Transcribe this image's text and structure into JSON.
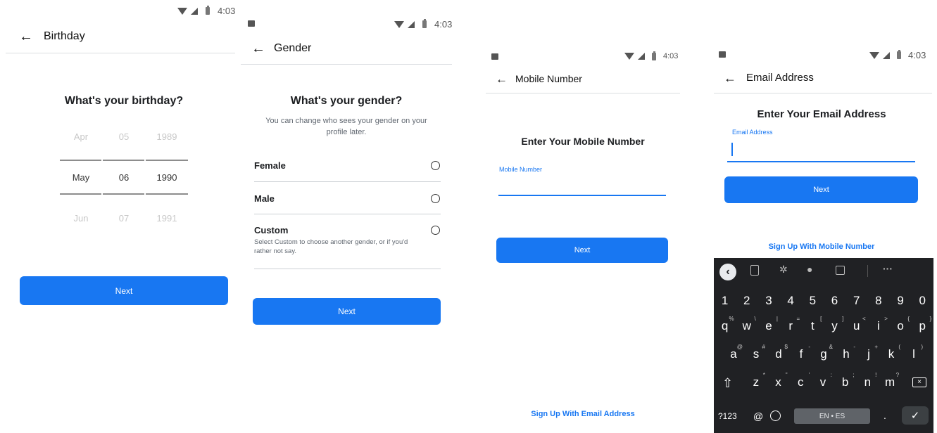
{
  "status_time": "4:03",
  "common": {
    "back_glyph": "←"
  },
  "screen1": {
    "title": "Birthday",
    "heading": "What's your birthday?",
    "months": [
      "Apr",
      "May",
      "Jun"
    ],
    "days": [
      "05",
      "06",
      "07"
    ],
    "years": [
      "1989",
      "1990",
      "1991"
    ],
    "next_label": "Next"
  },
  "screen2": {
    "title": "Gender",
    "heading": "What's your gender?",
    "subtitle": "You can change who sees your gender on your profile later.",
    "options": [
      {
        "label": "Female"
      },
      {
        "label": "Male"
      },
      {
        "label": "Custom",
        "desc": "Select Custom to choose another gender, or if you'd rather not say."
      }
    ],
    "next_label": "Next"
  },
  "screen3": {
    "title": "Mobile Number",
    "heading": "Enter Your Mobile Number",
    "field_label": "Mobile Number",
    "next_label": "Next",
    "alt_link": "Sign Up With Email Address"
  },
  "screen4": {
    "title": "Email Address",
    "heading": "Enter Your Email Address",
    "field_label": "Email Address",
    "next_label": "Next",
    "alt_link": "Sign Up With Mobile Number"
  },
  "keyboard": {
    "row_numbers": [
      "1",
      "2",
      "3",
      "4",
      "5",
      "6",
      "7",
      "8",
      "9",
      "0"
    ],
    "row_q": [
      {
        "k": "q",
        "s": "%"
      },
      {
        "k": "w",
        "s": "\\"
      },
      {
        "k": "e",
        "s": "|"
      },
      {
        "k": "r",
        "s": "="
      },
      {
        "k": "t",
        "s": "["
      },
      {
        "k": "y",
        "s": "]"
      },
      {
        "k": "u",
        "s": "<"
      },
      {
        "k": "i",
        "s": ">"
      },
      {
        "k": "o",
        "s": "{"
      },
      {
        "k": "p",
        "s": "}"
      }
    ],
    "row_a": [
      {
        "k": "a",
        "s": "@"
      },
      {
        "k": "s",
        "s": "#"
      },
      {
        "k": "d",
        "s": "$"
      },
      {
        "k": "f",
        "s": "-"
      },
      {
        "k": "g",
        "s": "&"
      },
      {
        "k": "h",
        "s": "-"
      },
      {
        "k": "j",
        "s": "+"
      },
      {
        "k": "k",
        "s": "("
      },
      {
        "k": "l",
        "s": ")"
      }
    ],
    "row_z": [
      {
        "k": "z",
        "s": "*"
      },
      {
        "k": "x",
        "s": "\""
      },
      {
        "k": "c",
        "s": "'"
      },
      {
        "k": "v",
        "s": ":"
      },
      {
        "k": "b",
        "s": ";"
      },
      {
        "k": "n",
        "s": "!"
      },
      {
        "k": "m",
        "s": "?"
      }
    ],
    "symbols_key": "?123",
    "at_key": "@",
    "space_label": "EN • ES",
    "period_key": ".",
    "toolbar_more": "···"
  }
}
